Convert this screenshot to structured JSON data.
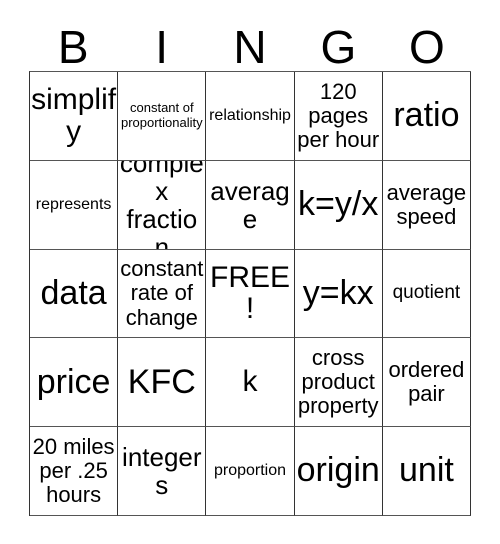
{
  "card": {
    "title": "BINGO",
    "header_letters": [
      "B",
      "I",
      "N",
      "G",
      "O"
    ],
    "free_space_label": "FREE!",
    "colors": {
      "text": "#000000",
      "grid_line": "#333333",
      "background": "#ffffff"
    },
    "rows": 5,
    "columns": 5,
    "cells": [
      [
        {
          "text": "simplify",
          "size": "2xl"
        },
        {
          "text": "constant of proportionality",
          "size": "xs"
        },
        {
          "text": "relationship",
          "size": "sm"
        },
        {
          "text": "120 pages per hour",
          "size": "lg"
        },
        {
          "text": "ratio",
          "size": "3xl"
        }
      ],
      [
        {
          "text": "represents",
          "size": "sm"
        },
        {
          "text": "complex fraction",
          "size": "xl"
        },
        {
          "text": "average",
          "size": "xl"
        },
        {
          "text": "k=y/x",
          "size": "3xl"
        },
        {
          "text": "average speed",
          "size": "lg"
        }
      ],
      [
        {
          "text": "data",
          "size": "3xl"
        },
        {
          "text": "constant rate of change",
          "size": "lg"
        },
        {
          "text": "FREE!",
          "size": "2xl"
        },
        {
          "text": "y=kx",
          "size": "3xl"
        },
        {
          "text": "quotient",
          "size": "md"
        }
      ],
      [
        {
          "text": "price",
          "size": "3xl"
        },
        {
          "text": "KFC",
          "size": "3xl"
        },
        {
          "text": "k",
          "size": "2xl"
        },
        {
          "text": "cross product property",
          "size": "lg"
        },
        {
          "text": "ordered pair",
          "size": "lg"
        }
      ],
      [
        {
          "text": "20 miles per .25 hours",
          "size": "lg"
        },
        {
          "text": "integers",
          "size": "xl"
        },
        {
          "text": "proportion",
          "size": "sm"
        },
        {
          "text": "origin",
          "size": "3xl"
        },
        {
          "text": "unit",
          "size": "3xl"
        }
      ]
    ]
  }
}
